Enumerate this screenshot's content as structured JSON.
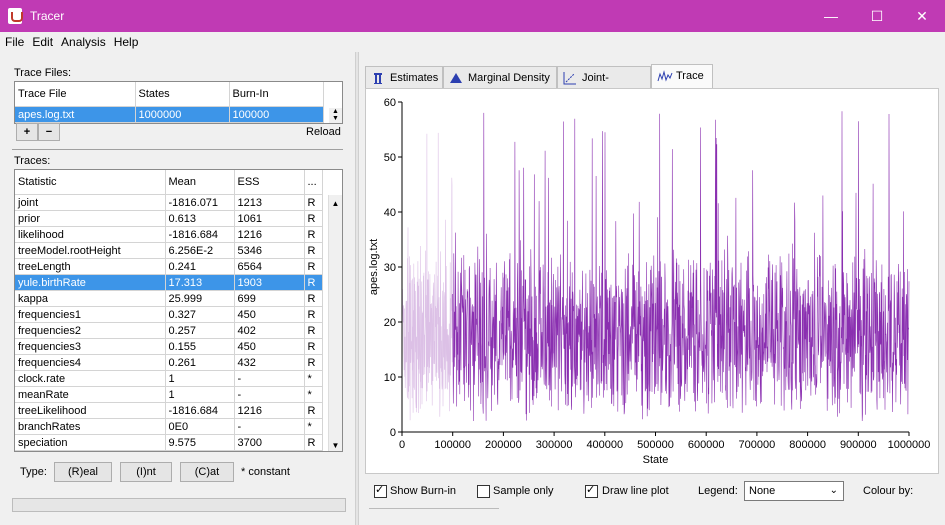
{
  "window": {
    "title": "Tracer"
  },
  "menu": [
    "File",
    "Edit",
    "Analysis",
    "Help"
  ],
  "trace_files": {
    "label": "Trace Files:",
    "headers": [
      "Trace File",
      "States",
      "Burn-In"
    ],
    "rows": [
      [
        "apes.log.txt",
        "1000000",
        "100000"
      ]
    ],
    "reload_label": "Reload",
    "add_label": "+",
    "remove_label": "−"
  },
  "traces": {
    "label": "Traces:",
    "headers": [
      "Statistic",
      "Mean",
      "ESS",
      "..."
    ],
    "rows": [
      [
        "joint",
        "-1816.071",
        "1213",
        "R"
      ],
      [
        "prior",
        "0.613",
        "1061",
        "R"
      ],
      [
        "likelihood",
        "-1816.684",
        "1216",
        "R"
      ],
      [
        "treeModel.rootHeight",
        "6.256E-2",
        "5346",
        "R"
      ],
      [
        "treeLength",
        "0.241",
        "6564",
        "R"
      ],
      [
        "yule.birthRate",
        "17.313",
        "1903",
        "R"
      ],
      [
        "kappa",
        "25.999",
        "699",
        "R"
      ],
      [
        "frequencies1",
        "0.327",
        "450",
        "R"
      ],
      [
        "frequencies2",
        "0.257",
        "402",
        "R"
      ],
      [
        "frequencies3",
        "0.155",
        "450",
        "R"
      ],
      [
        "frequencies4",
        "0.261",
        "432",
        "R"
      ],
      [
        "clock.rate",
        "1",
        "-",
        "*"
      ],
      [
        "meanRate",
        "1",
        "-",
        "*"
      ],
      [
        "treeLikelihood",
        "-1816.684",
        "1216",
        "R"
      ],
      [
        "branchRates",
        "0E0",
        "-",
        "*"
      ],
      [
        "speciation",
        "9.575",
        "3700",
        "R"
      ]
    ],
    "selected_index": 5
  },
  "type_bar": {
    "label": "Type:",
    "real": "(R)eal",
    "int": "(I)nt",
    "cat": "(C)at",
    "note": "* constant"
  },
  "tabs": [
    "Estimates",
    "Marginal Density",
    "Joint-Marginal",
    "Trace"
  ],
  "active_tab": "Trace",
  "bottom_bar": {
    "show_burnin": "Show Burn-in",
    "sample_only": "Sample only",
    "draw_line_plot": "Draw line plot",
    "legend_label": "Legend:",
    "legend_value": "None",
    "colour_by": "Colour by:"
  },
  "chart_data": {
    "type": "line",
    "xlabel": "State",
    "ylabel": "apes.log.txt",
    "xlim": [
      0,
      1000000
    ],
    "ylim": [
      0,
      60
    ],
    "xticks": [
      "0",
      "100000",
      "200000",
      "300000",
      "400000",
      "500000",
      "600000",
      "700000",
      "800000",
      "900000",
      "1000000"
    ],
    "yticks": [
      "0",
      "10",
      "20",
      "30",
      "40",
      "50",
      "60"
    ],
    "burnin": 100000,
    "colors": {
      "burnin": "#dcc0e6",
      "trace": "#8a2fb0"
    },
    "series": [
      {
        "values_summary": {
          "typical_min": 5,
          "typical_max": 30,
          "peak_max": 59
        }
      }
    ]
  }
}
